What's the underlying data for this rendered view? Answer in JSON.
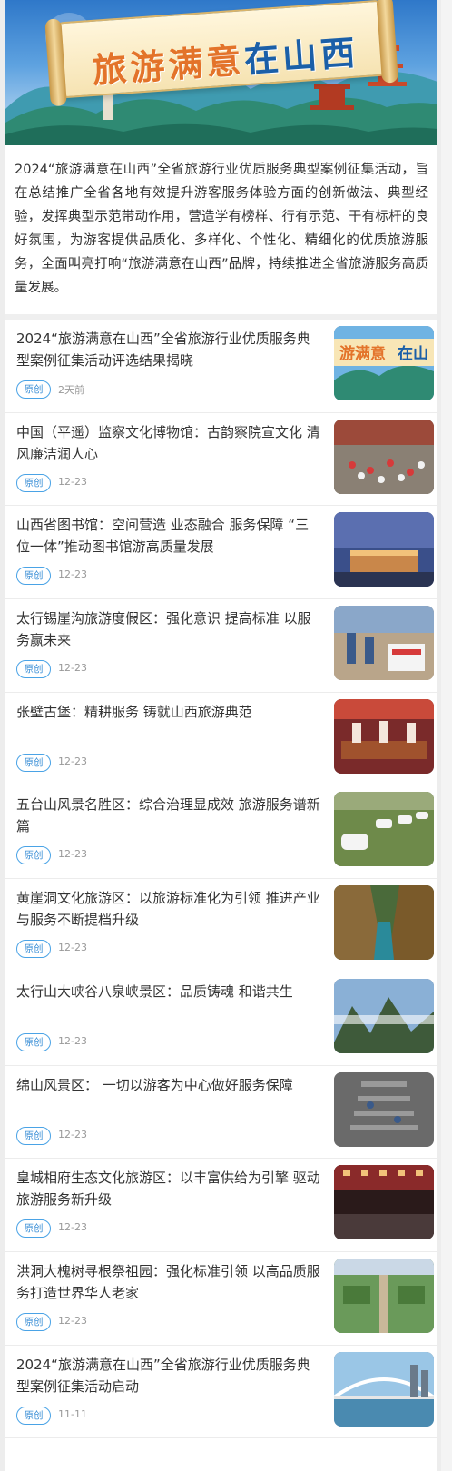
{
  "banner": {
    "title_part1": "旅游满意",
    "title_part2": "在山西"
  },
  "intro": {
    "text": "2024“旅游满意在山西”全省旅游行业优质服务典型案例征集活动，旨在总结推广全省各地有效提升游客服务体验方面的创新做法、典型经验，发挥典型示范带动作用，营造学有榜样、行有示范、干有标杆的良好氛围，为游客提供品质化、多样化、个性化、精细化的优质旅游服务，全面叫亮打响“旅游满意在山西”品牌，持续推进全省旅游服务高质量发展。"
  },
  "articles": [
    {
      "title": "2024“旅游满意在山西”全省旅游行业优质服务典型案例征集活动评选结果揭晓",
      "badge": "原创",
      "date": "2天前",
      "thumb": "banner-thumb"
    },
    {
      "title": "中国（平遥）监察文化博物馆：古韵察院宣文化 清风廉洁润人心",
      "badge": "原创",
      "date": "12-23",
      "thumb": "crowd-thumb"
    },
    {
      "title": "山西省图书馆：空间营造 业态融合 服务保障 “三位一体”推动图书馆游高质量发展",
      "badge": "原创",
      "date": "12-23",
      "thumb": "library-thumb"
    },
    {
      "title": "太行锡崖沟旅游度假区：强化意识  提高标准  以服务赢未来",
      "badge": "原创",
      "date": "12-23",
      "thumb": "service-thumb"
    },
    {
      "title": "张壁古堡：精耕服务 铸就山西旅游典范",
      "badge": "原创",
      "date": "12-23",
      "thumb": "tea-thumb"
    },
    {
      "title": "五台山风景名胜区：综合治理显成效  旅游服务谱新篇",
      "badge": "原创",
      "date": "12-23",
      "thumb": "camp-thumb"
    },
    {
      "title": "黄崖洞文化旅游区：以旅游标准化为引领 推进产业与服务不断提档升级",
      "badge": "原创",
      "date": "12-23",
      "thumb": "canyon-thumb"
    },
    {
      "title": "太行山大峡谷八泉峡景区：品质铸魂  和谐共生",
      "badge": "原创",
      "date": "12-23",
      "thumb": "mountain-thumb"
    },
    {
      "title": "绵山风景区： 一切以游客为中心做好服务保障",
      "badge": "原创",
      "date": "12-23",
      "thumb": "stairs-thumb"
    },
    {
      "title": "皇城相府生态文化旅游区：以丰富供给为引擎  驱动旅游服务新升级",
      "badge": "原创",
      "date": "12-23",
      "thumb": "night-thumb"
    },
    {
      "title": "洪洞大槐树寻根祭祖园：强化标准引领 以高品质服务打造世界华人老家",
      "badge": "原创",
      "date": "12-23",
      "thumb": "aerial-thumb"
    },
    {
      "title": "2024“旅游满意在山西”全省旅游行业优质服务典型案例征集活动启动",
      "badge": "原创",
      "date": "11-11",
      "thumb": "bridge-thumb"
    }
  ],
  "colors": {
    "accent_blue": "#3b8fd6",
    "title_orange": "#e3732a",
    "title_blue": "#1b5fa8"
  }
}
